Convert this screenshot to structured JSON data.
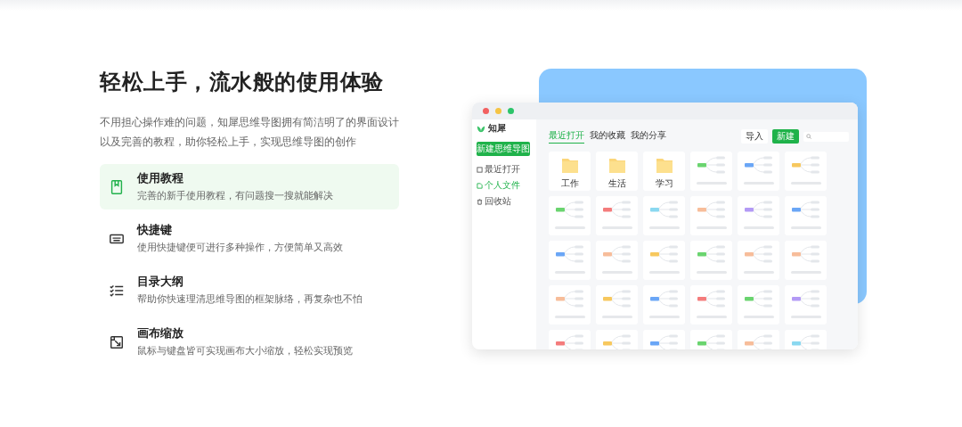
{
  "title": "轻松上手，流水般的使用体验",
  "intro": "不用担心操作难的问题，知犀思维导图拥有简洁明了的界面设计以及完善的教程，助你轻松上手，实现思维导图的创作",
  "features": [
    {
      "kind": "book",
      "title": "使用教程",
      "desc": "完善的新手使用教程，有问题搜一搜就能解决",
      "selected": true
    },
    {
      "kind": "keyboard",
      "title": "快捷键",
      "desc": "使用快捷键便可进行多种操作，方便简单又高效",
      "selected": false
    },
    {
      "kind": "outline",
      "title": "目录大纲",
      "desc": "帮助你快速理清思维导图的框架脉络，再复杂也不怕",
      "selected": false
    },
    {
      "kind": "zoom",
      "title": "画布缩放",
      "desc": "鼠标与键盘皆可实现画布大小缩放，轻松实现预览",
      "selected": false
    }
  ],
  "mockup": {
    "logo": "知犀",
    "new_button": "新建思维导图",
    "sidebar": [
      {
        "kind": "recent",
        "label": "最近打开",
        "selected": false
      },
      {
        "kind": "folder",
        "label": "个人文件",
        "selected": true
      },
      {
        "kind": "trash",
        "label": "回收站",
        "selected": false
      }
    ],
    "tabs": [
      {
        "label": "最近打开",
        "selected": true
      },
      {
        "label": "我的收藏",
        "selected": false
      },
      {
        "label": "我的分享",
        "selected": false
      }
    ],
    "import_button": "导入",
    "create_button": "新建",
    "files": [
      {
        "kind": "folder",
        "name": "工作"
      },
      {
        "kind": "folder",
        "name": "生活"
      },
      {
        "kind": "folder",
        "name": "学习"
      },
      {
        "kind": "map",
        "color": "#6ad46f"
      },
      {
        "kind": "map",
        "color": "#6aa6f6"
      },
      {
        "kind": "map",
        "color": "#f7c85e"
      },
      {
        "kind": "map",
        "color": "#6ad46f"
      },
      {
        "kind": "map",
        "color": "#f47c7c"
      },
      {
        "kind": "map",
        "color": "#8ad8f0"
      },
      {
        "kind": "map",
        "color": "#f7bd9a"
      },
      {
        "kind": "map",
        "color": "#b39af5"
      },
      {
        "kind": "map",
        "color": "#6aa6f6"
      },
      {
        "kind": "map",
        "color": "#6aa6f6"
      },
      {
        "kind": "map",
        "color": "#f7bd9a"
      },
      {
        "kind": "map",
        "color": "#f7c85e"
      },
      {
        "kind": "map",
        "color": "#6ad46f"
      },
      {
        "kind": "map",
        "color": "#f7bd9a"
      },
      {
        "kind": "map",
        "color": "#f7bd9a"
      },
      {
        "kind": "map",
        "color": "#f7bd9a"
      },
      {
        "kind": "map",
        "color": "#f7c85e"
      },
      {
        "kind": "map",
        "color": "#6aa6f6"
      },
      {
        "kind": "map",
        "color": "#f47c7c"
      },
      {
        "kind": "map",
        "color": "#6ad46f"
      },
      {
        "kind": "map",
        "color": "#b39af5"
      },
      {
        "kind": "map",
        "color": "#f47c7c"
      },
      {
        "kind": "map",
        "color": "#f7c85e"
      },
      {
        "kind": "map",
        "color": "#6aa6f6"
      },
      {
        "kind": "map",
        "color": "#6ad46f"
      },
      {
        "kind": "map",
        "color": "#f7bd9a"
      },
      {
        "kind": "map",
        "color": "#8ad8f0"
      }
    ]
  }
}
